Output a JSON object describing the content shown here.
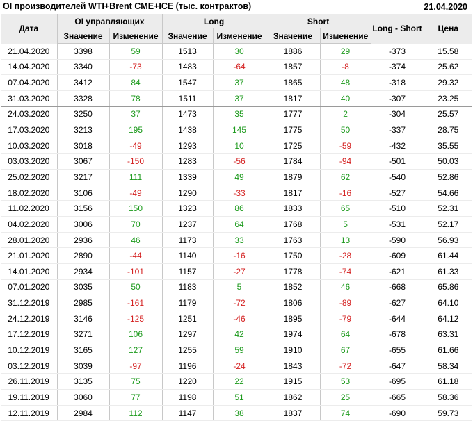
{
  "header": {
    "title": "OI производителей WTI+Brent CME+ICE (тыс. контрактов)",
    "date": "21.04.2020"
  },
  "table": {
    "col_date": "Дата",
    "group_oi": "OI управляющих",
    "group_long": "Long",
    "group_short": "Short",
    "col_ls": "Long - Short",
    "col_price": "Цена",
    "sub_value": "Значение",
    "sub_change": "Изменение",
    "colors": {
      "positive": "#1c9a1c",
      "negative": "#d42020"
    },
    "rows": [
      [
        "21.04.2020",
        "3398",
        "59",
        "1513",
        "30",
        "1886",
        "29",
        "-373",
        "15.58"
      ],
      [
        "14.04.2020",
        "3340",
        "-73",
        "1483",
        "-64",
        "1857",
        "-8",
        "-374",
        "25.62"
      ],
      [
        "07.04.2020",
        "3412",
        "84",
        "1547",
        "37",
        "1865",
        "48",
        "-318",
        "29.32"
      ],
      [
        "31.03.2020",
        "3328",
        "78",
        "1511",
        "37",
        "1817",
        "40",
        "-307",
        "23.25"
      ],
      [
        "24.03.2020",
        "3250",
        "37",
        "1473",
        "35",
        "1777",
        "2",
        "-304",
        "25.57"
      ],
      [
        "17.03.2020",
        "3213",
        "195",
        "1438",
        "145",
        "1775",
        "50",
        "-337",
        "28.75"
      ],
      [
        "10.03.2020",
        "3018",
        "-49",
        "1293",
        "10",
        "1725",
        "-59",
        "-432",
        "35.55"
      ],
      [
        "03.03.2020",
        "3067",
        "-150",
        "1283",
        "-56",
        "1784",
        "-94",
        "-501",
        "50.03"
      ],
      [
        "25.02.2020",
        "3217",
        "111",
        "1339",
        "49",
        "1879",
        "62",
        "-540",
        "52.86"
      ],
      [
        "18.02.2020",
        "3106",
        "-49",
        "1290",
        "-33",
        "1817",
        "-16",
        "-527",
        "54.66"
      ],
      [
        "11.02.2020",
        "3156",
        "150",
        "1323",
        "86",
        "1833",
        "65",
        "-510",
        "52.31"
      ],
      [
        "04.02.2020",
        "3006",
        "70",
        "1237",
        "64",
        "1768",
        "5",
        "-531",
        "52.17"
      ],
      [
        "28.01.2020",
        "2936",
        "46",
        "1173",
        "33",
        "1763",
        "13",
        "-590",
        "56.93"
      ],
      [
        "21.01.2020",
        "2890",
        "-44",
        "1140",
        "-16",
        "1750",
        "-28",
        "-609",
        "61.44"
      ],
      [
        "14.01.2020",
        "2934",
        "-101",
        "1157",
        "-27",
        "1778",
        "-74",
        "-621",
        "61.33"
      ],
      [
        "07.01.2020",
        "3035",
        "50",
        "1183",
        "5",
        "1852",
        "46",
        "-668",
        "65.86"
      ],
      [
        "31.12.2019",
        "2985",
        "-161",
        "1179",
        "-72",
        "1806",
        "-89",
        "-627",
        "64.10"
      ],
      [
        "24.12.2019",
        "3146",
        "-125",
        "1251",
        "-46",
        "1895",
        "-79",
        "-644",
        "64.12"
      ],
      [
        "17.12.2019",
        "3271",
        "106",
        "1297",
        "42",
        "1974",
        "64",
        "-678",
        "63.31"
      ],
      [
        "10.12.2019",
        "3165",
        "127",
        "1255",
        "59",
        "1910",
        "67",
        "-655",
        "61.66"
      ],
      [
        "03.12.2019",
        "3039",
        "-97",
        "1196",
        "-24",
        "1843",
        "-72",
        "-647",
        "58.34"
      ],
      [
        "26.11.2019",
        "3135",
        "75",
        "1220",
        "22",
        "1915",
        "53",
        "-695",
        "61.18"
      ],
      [
        "19.11.2019",
        "3060",
        "77",
        "1198",
        "51",
        "1862",
        "25",
        "-665",
        "58.36"
      ],
      [
        "12.11.2019",
        "2984",
        "112",
        "1147",
        "38",
        "1837",
        "74",
        "-690",
        "59.73"
      ]
    ]
  }
}
